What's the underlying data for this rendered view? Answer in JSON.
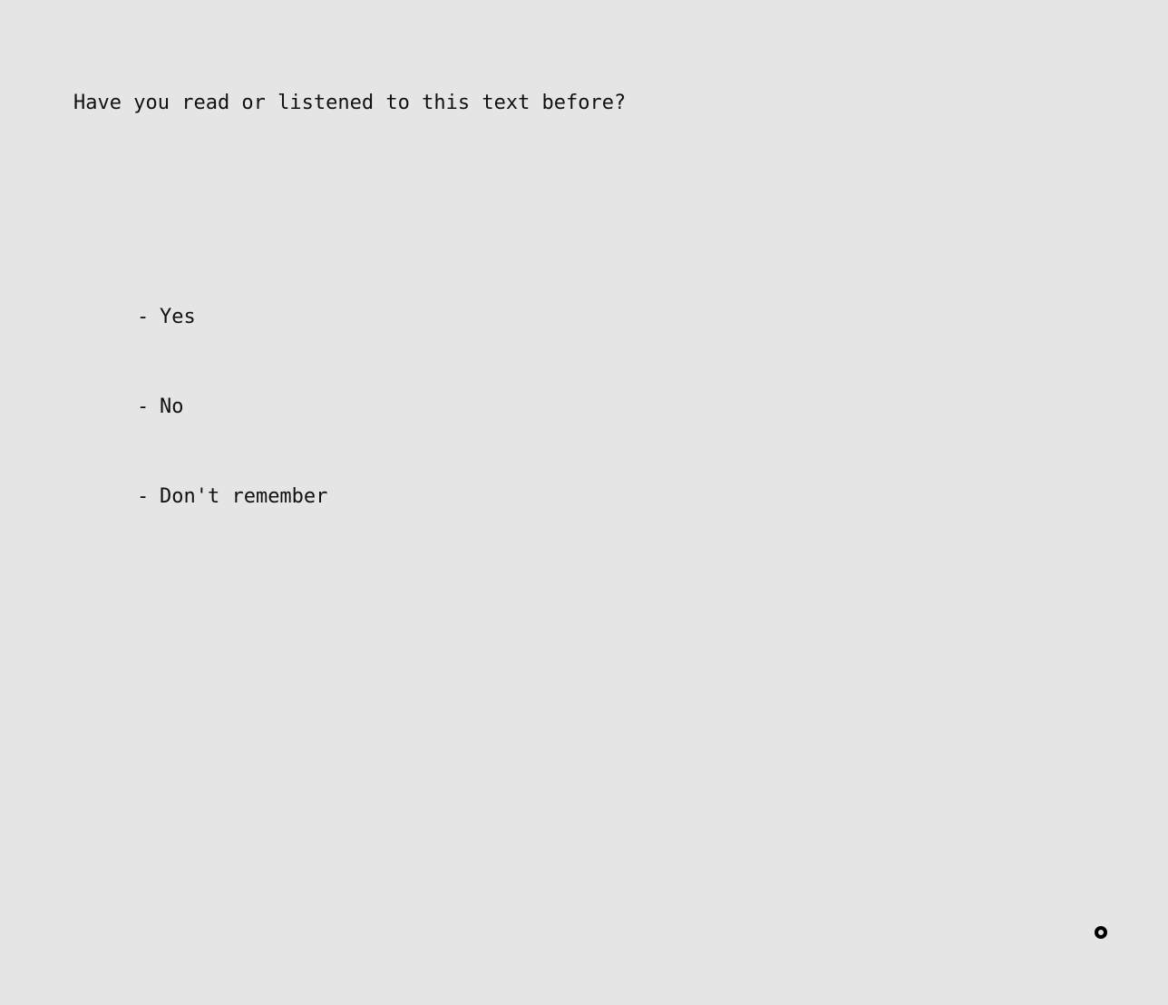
{
  "question": {
    "text": "Have you read or listened to this text before?"
  },
  "options": [
    {
      "bullet": "-",
      "label": "Yes"
    },
    {
      "bullet": "-",
      "label": "No"
    },
    {
      "bullet": "-",
      "label": "Don't remember"
    }
  ],
  "colors": {
    "background": "#e5e5e5",
    "text": "#111111",
    "dot": "#000000"
  },
  "icons": {
    "corner_marker": "fixation-dot-icon"
  }
}
